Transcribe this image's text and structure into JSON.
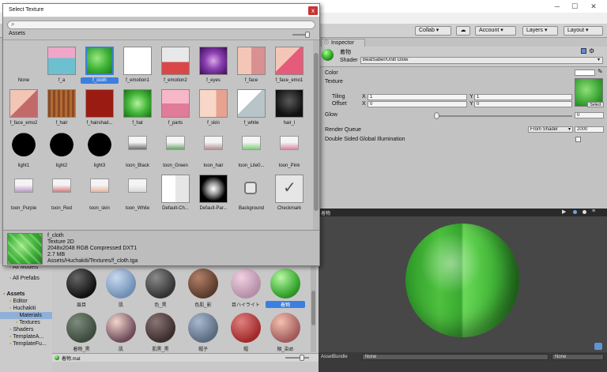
{
  "editor": {
    "toolbar": {
      "collab": "Collab ▾",
      "cloud_icon": "cloud-icon",
      "account": "Account ▾",
      "layers": "Layers ▾",
      "layout": "Layout ▾"
    },
    "window_controls": {
      "minimize": "─",
      "maximize": "☐",
      "close": "✕"
    }
  },
  "inspector": {
    "tab": "Inspector",
    "material_name": "着物",
    "shader_label": "Shader",
    "shader_value": "BeatSaber/Unlit Glow",
    "properties": {
      "color_label": "Color",
      "texture_label": "Texture",
      "tiling_label": "Tiling",
      "offset_label": "Offset",
      "tiling_x": "1",
      "tiling_y": "1",
      "offset_x": "0",
      "offset_y": "0",
      "x": "X",
      "y": "Y",
      "glow_label": "Glow",
      "glow_value": "0",
      "select_button": "Select",
      "render_queue_label": "Render Queue",
      "render_queue_mode": "From Shader",
      "render_queue_value": "2000",
      "dsgi_label": "Double Sided Global Illumination"
    }
  },
  "preview": {
    "title": "着物",
    "assetbundle_label": "AssetBundle",
    "assetbundle_value": "None",
    "variant_value": "None"
  },
  "dialog": {
    "title": "Select Texture",
    "close": "x",
    "search_placeholder": "",
    "tab": "Assets",
    "textures": [
      {
        "name": "None"
      },
      {
        "name": "f_a"
      },
      {
        "name": "f_cloth"
      },
      {
        "name": "f_emotion1"
      },
      {
        "name": "f_emotion2"
      },
      {
        "name": "f_eyes"
      },
      {
        "name": "f_face"
      },
      {
        "name": "f_face_emo1"
      },
      {
        "name": "f_face_emo2"
      },
      {
        "name": "f_hair"
      },
      {
        "name": "f_hairshad..."
      },
      {
        "name": "f_hat"
      },
      {
        "name": "f_parts"
      },
      {
        "name": "f_skin"
      },
      {
        "name": "f_white"
      },
      {
        "name": "hair_l"
      },
      {
        "name": "light1"
      },
      {
        "name": "light2"
      },
      {
        "name": "light3"
      },
      {
        "name": "toon_Black"
      },
      {
        "name": "toon_Green"
      },
      {
        "name": "toon_hair"
      },
      {
        "name": "toon_Lite0..."
      },
      {
        "name": "toon_Pink"
      },
      {
        "name": "toon_Purple"
      },
      {
        "name": "toon_Red"
      },
      {
        "name": "toon_skin"
      },
      {
        "name": "toon_White"
      },
      {
        "name": "Default-Ch..."
      },
      {
        "name": "Default-Par..."
      },
      {
        "name": "Background"
      },
      {
        "name": "Checkmark"
      }
    ],
    "selected_index": 2,
    "info": {
      "name": "f_cloth",
      "type": "Texture 2D",
      "format": "2048x2048  RGB Compressed DXT1",
      "size": "2.7 MB",
      "path": "Assets/Huchakiti/Textures/f_cloth.tga"
    }
  },
  "project": {
    "tree": [
      {
        "label": "All Models",
        "indent": 1
      },
      {
        "label": "All Prefabs",
        "indent": 1
      },
      {
        "label": "Assets",
        "indent": 0,
        "bold": true
      },
      {
        "label": "Editor",
        "indent": 1
      },
      {
        "label": "Huchakiti",
        "indent": 1
      },
      {
        "label": "Materials",
        "indent": 2,
        "selected": true
      },
      {
        "label": "Textures",
        "indent": 2
      },
      {
        "label": "Shaders",
        "indent": 1
      },
      {
        "label": "TemplateA...",
        "indent": 1
      },
      {
        "label": "TemplateFu...",
        "indent": 1
      }
    ],
    "materials": [
      {
        "label": "眉目"
      },
      {
        "label": "肌"
      },
      {
        "label": "色_黒"
      },
      {
        "label": "色肌_影"
      },
      {
        "label": "目ハイライト"
      },
      {
        "label": "着物",
        "selected": true
      },
      {
        "label": "着物_黒"
      },
      {
        "label": "肌"
      },
      {
        "label": "肌黒_黒"
      },
      {
        "label": "帽子"
      },
      {
        "label": "帽"
      },
      {
        "label": "頬_染め"
      }
    ],
    "footer_file": "着物.mat"
  }
}
